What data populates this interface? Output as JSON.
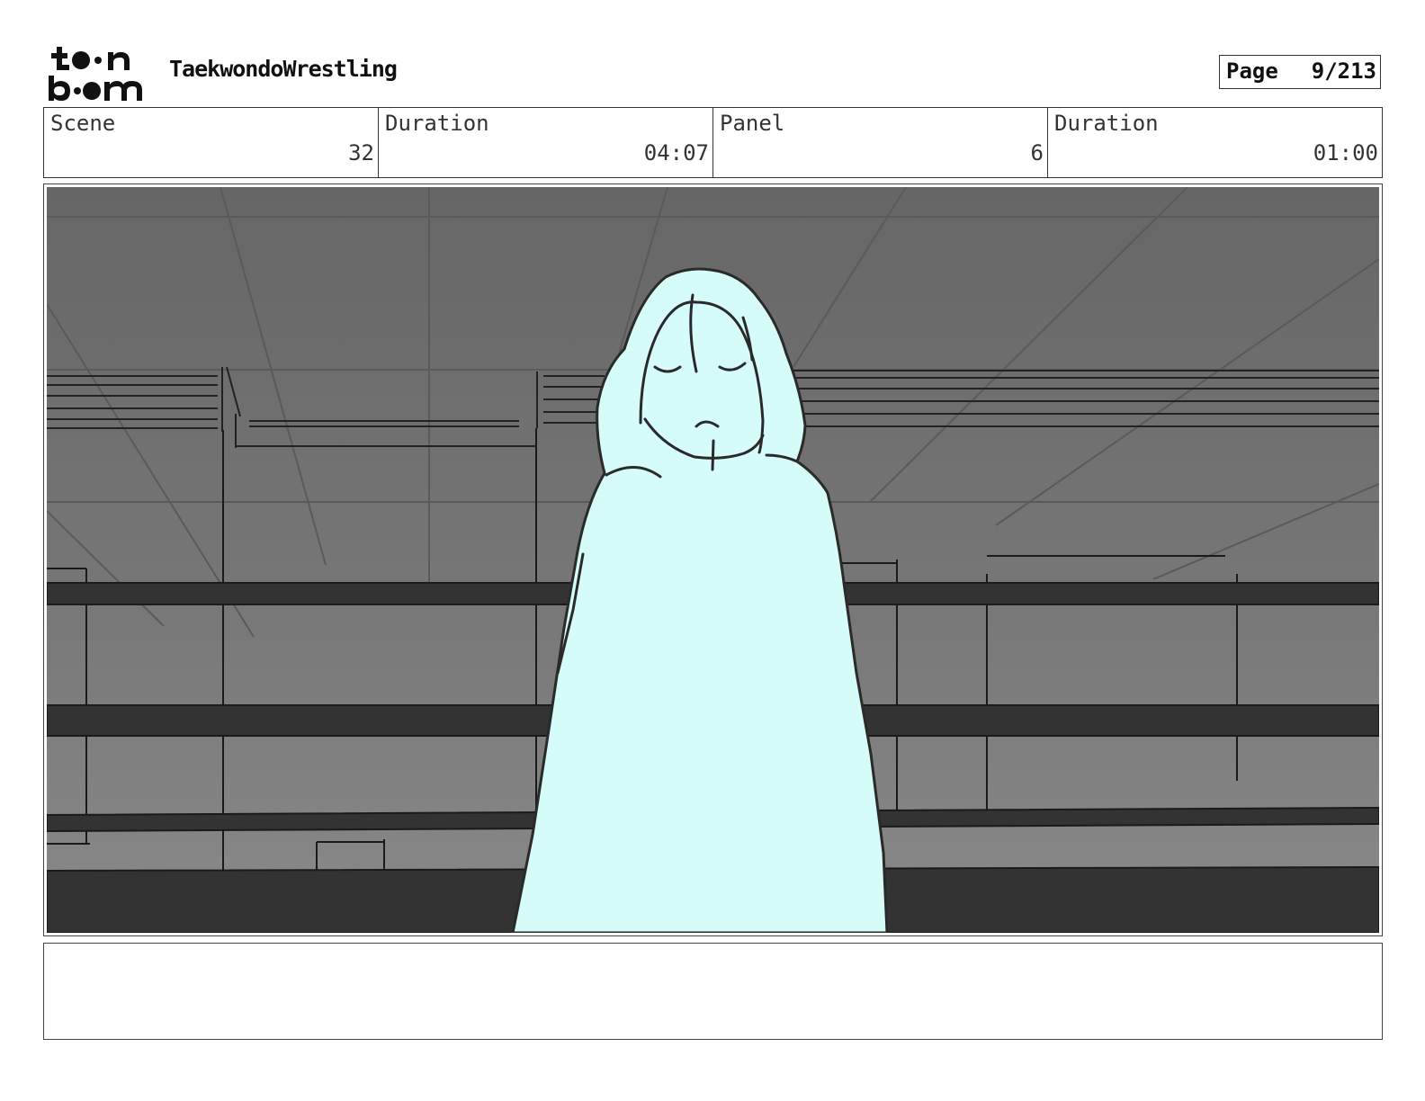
{
  "header": {
    "project_title": "TaekwondoWrestling",
    "page_label": "Page",
    "page_value": "9/213"
  },
  "info": {
    "scene_label": "Scene",
    "scene_value": "32",
    "scene_duration_label": "Duration",
    "scene_duration_value": "04:07",
    "panel_label": "Panel",
    "panel_value": "6",
    "panel_duration_label": "Duration",
    "panel_duration_value": "01:00"
  },
  "colors": {
    "figure_fill": "#d6fcfa",
    "background_gray": "#727272",
    "bar_dark": "#333333"
  },
  "icons": {
    "logo": "toon-boom-logo"
  }
}
